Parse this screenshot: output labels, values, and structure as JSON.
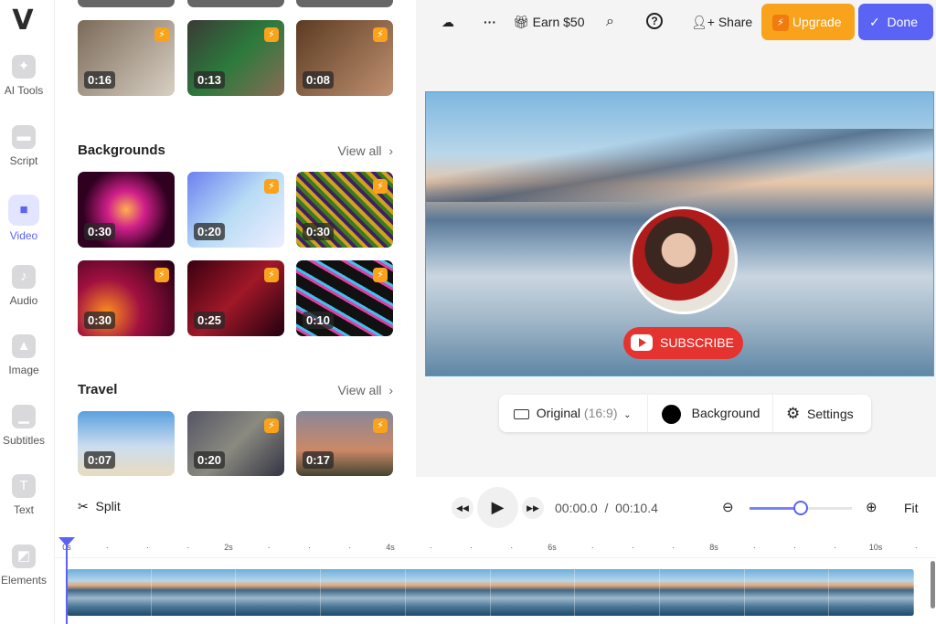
{
  "rail": {
    "logo": "V",
    "items": [
      {
        "label": "AI Tools",
        "icon": "sparkle-icon",
        "glyph": "✦"
      },
      {
        "label": "Script",
        "icon": "script-icon",
        "glyph": "▬"
      },
      {
        "label": "Video",
        "icon": "video-icon",
        "glyph": "■",
        "active": true
      },
      {
        "label": "Audio",
        "icon": "music-icon",
        "glyph": "♪"
      },
      {
        "label": "Image",
        "icon": "image-icon",
        "glyph": "▲"
      },
      {
        "label": "Subtitles",
        "icon": "subtitles-icon",
        "glyph": "▁"
      },
      {
        "label": "Text",
        "icon": "text-icon",
        "glyph": "T"
      },
      {
        "label": "Elements",
        "icon": "elements-icon",
        "glyph": "◩"
      }
    ]
  },
  "panel": {
    "top_row": [
      {
        "duration": "0:16",
        "premium": true
      },
      {
        "duration": "0:13",
        "premium": true
      },
      {
        "duration": "0:08",
        "premium": true
      }
    ],
    "sections": [
      {
        "title": "Backgrounds",
        "view_all": "View all",
        "items": [
          {
            "duration": "0:30",
            "premium": false
          },
          {
            "duration": "0:20",
            "premium": true
          },
          {
            "duration": "0:30",
            "premium": true
          },
          {
            "duration": "0:30",
            "premium": true
          },
          {
            "duration": "0:25",
            "premium": true
          },
          {
            "duration": "0:10",
            "premium": true
          }
        ]
      },
      {
        "title": "Travel",
        "view_all": "View all",
        "items": [
          {
            "duration": "0:07",
            "premium": false
          },
          {
            "duration": "0:20",
            "premium": true
          },
          {
            "duration": "0:17",
            "premium": true
          }
        ]
      }
    ]
  },
  "toolbar": {
    "earn": "Earn $50",
    "share": "Share",
    "upgrade": "Upgrade",
    "done": "Done",
    "upgrade_color": "#f9a21b",
    "done_color": "#5b63f5"
  },
  "canvas": {
    "subscribe": "SUBSCRIBE"
  },
  "canvas_bar": {
    "aspect": "Original",
    "aspect_ratio": "(16:9)",
    "background": "Background",
    "settings": "Settings"
  },
  "timeline": {
    "split": "Split",
    "current": "00:00.0",
    "separator": "/",
    "total": "00:10.4",
    "fit": "Fit",
    "zoom_level": 0.5,
    "ticks": [
      "0s",
      "2s",
      "4s",
      "6s",
      "8s",
      "10s"
    ]
  }
}
